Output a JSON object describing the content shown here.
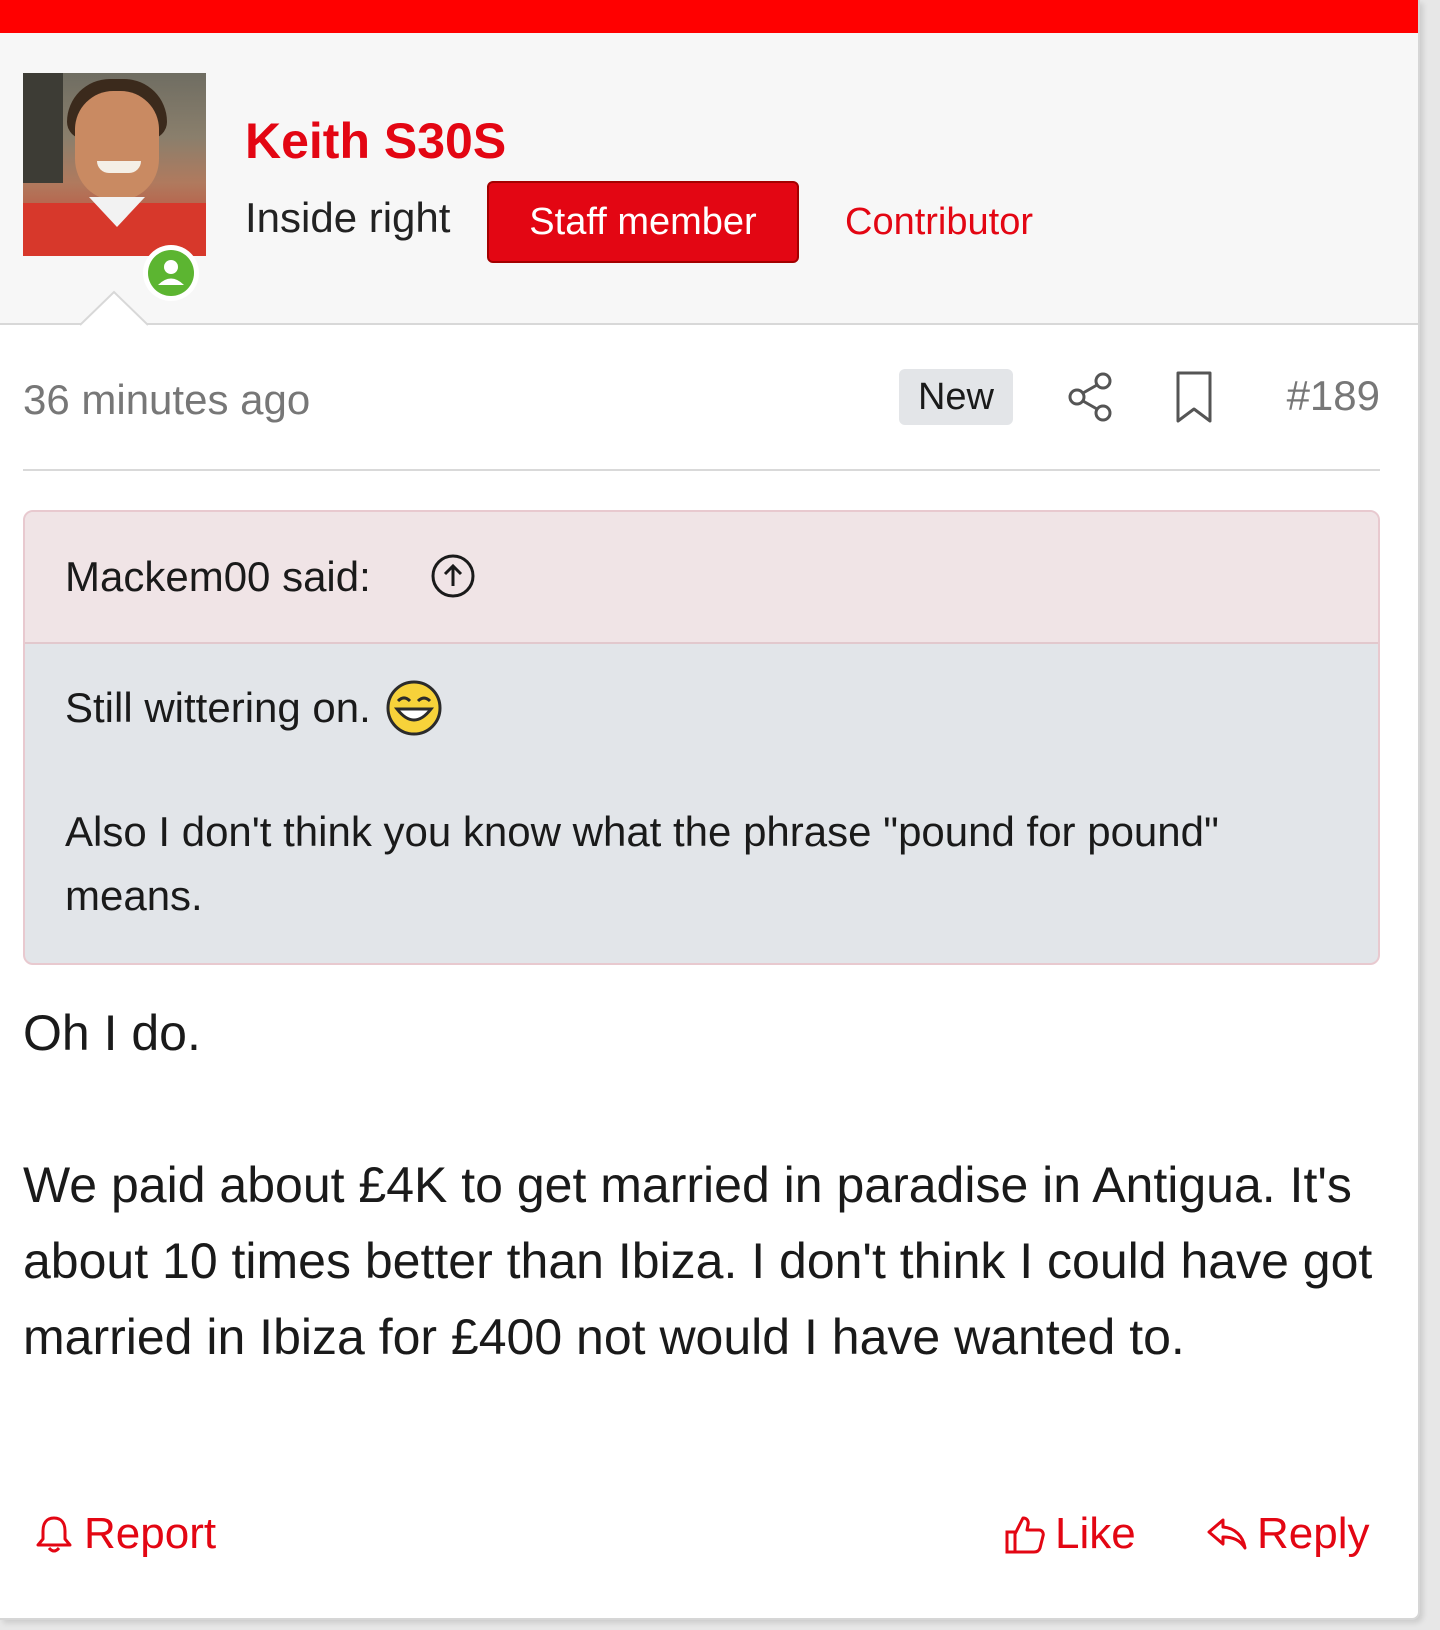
{
  "colors": {
    "accent": "#e30613",
    "top_bar": "#ff0000",
    "online": "#5cb531",
    "quote_header_bg": "#f0e4e6",
    "quote_body_bg": "#e2e5e9"
  },
  "user": {
    "name": "Keith S30S",
    "title": "Inside right",
    "badges": {
      "staff": "Staff member",
      "contributor": "Contributor"
    },
    "avatar_icon": "avatar-photo",
    "online_icon": "online-user-icon"
  },
  "meta": {
    "timestamp": "36 minutes ago",
    "new_label": "New",
    "share_icon": "share-icon",
    "bookmark_icon": "bookmark-icon",
    "post_number": "#189"
  },
  "quote": {
    "author": "Mackem00 said:",
    "jump_icon": "arrow-up-circle-icon",
    "line1": "Still wittering on.",
    "smiley_icon": "laughing-smiley-icon",
    "line2": "Also I don't think you know what the phrase \"pound for pound\" means."
  },
  "message": {
    "paragraphs": [
      "Oh I do.",
      "We paid about £4K to get married in paradise in Antigua. It's about 10 times better than Ibiza. I don't think I could have got married in Ibiza for £400 not would I have wanted to."
    ]
  },
  "actions": {
    "report": "Report",
    "like": "Like",
    "reply": "Reply"
  }
}
